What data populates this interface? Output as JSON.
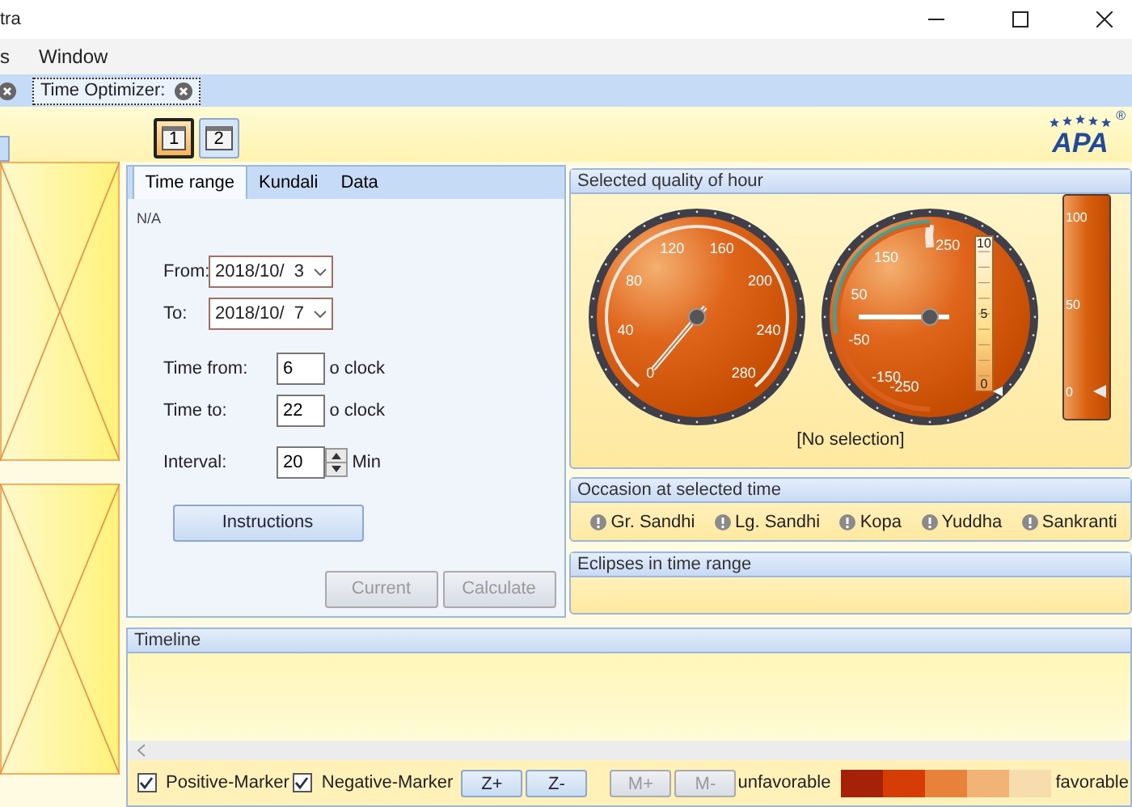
{
  "window": {
    "title": "tra"
  },
  "menu": [
    "s",
    "Window"
  ],
  "doc_tabs": [
    {
      "selected": false
    },
    {
      "label": "Time Optimizer:",
      "selected": true
    }
  ],
  "view_buttons": [
    {
      "label": "1",
      "selected": true
    },
    {
      "label": "2",
      "selected": false
    }
  ],
  "logo": {
    "text": "APA",
    "mark": "®"
  },
  "tabs": [
    {
      "label": "Time range",
      "selected": true
    },
    {
      "label": "Kundali",
      "selected": false
    },
    {
      "label": "Data",
      "selected": false
    }
  ],
  "form": {
    "status": "N/A",
    "from": {
      "label": "From:",
      "value": "2018/10/  3"
    },
    "to": {
      "label": "To:",
      "value": "2018/10/  7"
    },
    "time_from": {
      "label": "Time from:",
      "value": "6",
      "unit": "o clock"
    },
    "time_to": {
      "label": "Time to:",
      "value": "22",
      "unit": "o clock"
    },
    "interval": {
      "label": "Interval:",
      "value": "20",
      "unit": "Min"
    },
    "instructions": {
      "label": "Instructions"
    },
    "buttons": [
      {
        "label": "Current",
        "disabled": true
      },
      {
        "label": "Calculate",
        "disabled": true
      }
    ]
  },
  "quality": {
    "title": "Selected quality of hour",
    "gauges": [
      {
        "kind": "dial",
        "labels": [
          "0",
          "40",
          "80",
          "120",
          "160",
          "200",
          "240",
          "280"
        ]
      },
      {
        "kind": "half",
        "labels": [
          "250",
          "150",
          "50",
          "-50",
          "-150",
          "-250"
        ],
        "scale": {
          "labels": [
            "10",
            "5",
            "0"
          ]
        }
      }
    ],
    "meter": {
      "labels": [
        "100",
        "50",
        "0"
      ]
    },
    "caption": "[No selection]"
  },
  "occasion": {
    "title": "Occasion at selected time",
    "items": [
      "Gr. Sandhi",
      "Lg. Sandhi",
      "Kopa",
      "Yuddha",
      "Sankranti"
    ]
  },
  "eclipses": {
    "title": "Eclipses in time range"
  },
  "timeline": {
    "title": "Timeline",
    "markers": [
      {
        "label": "Positive-Marker",
        "checked": true
      },
      {
        "label": "Negative-Marker",
        "checked": true
      }
    ],
    "buttons": [
      {
        "label": "Z+",
        "disabled": false
      },
      {
        "label": "Z-",
        "disabled": false
      },
      {
        "label": "M+",
        "disabled": true
      },
      {
        "label": "M-",
        "disabled": true
      }
    ],
    "legend": {
      "low": "unfavorable",
      "high": "favorable",
      "swatches": [
        {
          "color": "#a52208"
        },
        {
          "color": "#d63c06"
        },
        {
          "color": "#e8823a"
        },
        {
          "color": "#f2b476"
        },
        {
          "color": "#f7dcae"
        }
      ]
    }
  }
}
